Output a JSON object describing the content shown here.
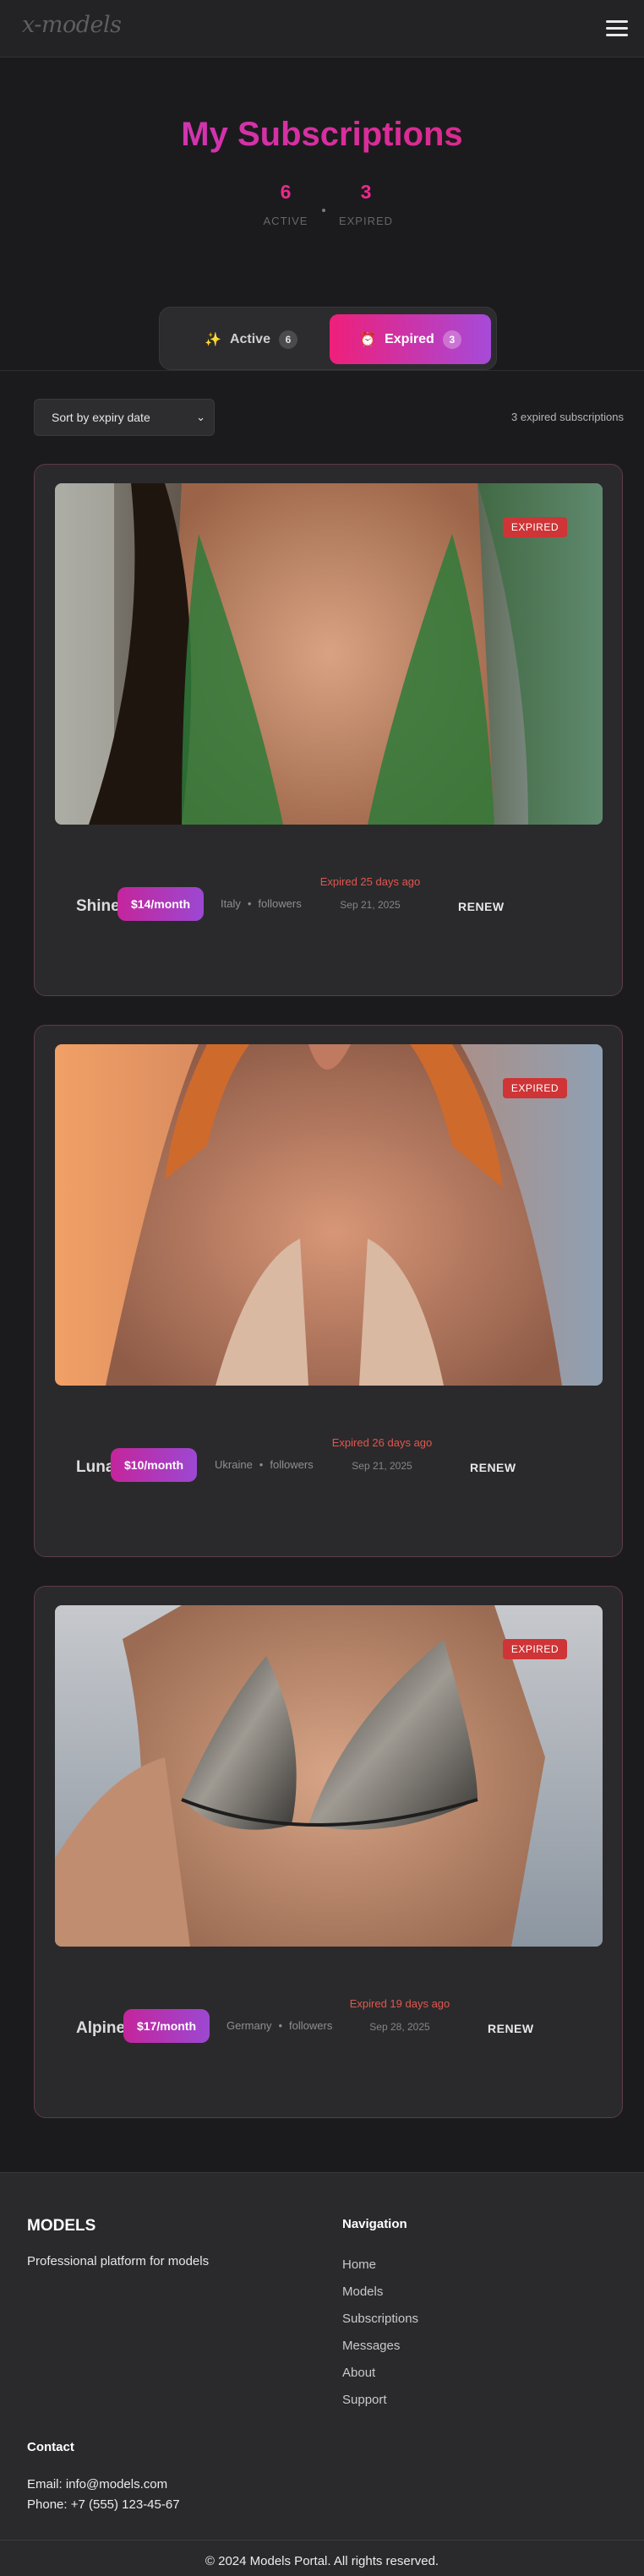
{
  "header": {
    "logo_text": "x-models",
    "menu_icon": "hamburger-icon"
  },
  "page": {
    "title": "My Subscriptions",
    "stats": [
      {
        "value": "6",
        "label": "ACTIVE"
      },
      {
        "value": "3",
        "label": "EXPIRED"
      }
    ]
  },
  "tabs": [
    {
      "icon": "sparkles-icon",
      "label": "Active",
      "count": "6",
      "selected": false
    },
    {
      "icon": "alarm-clock-icon",
      "label": "Expired",
      "count": "3",
      "selected": true
    }
  ],
  "toolbar": {
    "sort_value": "Sort by expiry date",
    "count_text": "3 expired subscriptions"
  },
  "subscriptions": [
    {
      "name": "Shine",
      "price": "$14/month",
      "country": "Italy",
      "followers": "followers",
      "expired_text": "Expired 25 days ago",
      "expired_date": "Sep 21, 2025",
      "badge": "EXPIRED",
      "action": "RENEW"
    },
    {
      "name": "Luna",
      "price": "$10/month",
      "country": "Ukraine",
      "followers": "followers",
      "expired_text": "Expired 26 days ago",
      "expired_date": "Sep 21, 2025",
      "badge": "EXPIRED",
      "action": "RENEW"
    },
    {
      "name": "Alpine",
      "price": "$17/month",
      "country": "Germany",
      "followers": "followers",
      "expired_text": "Expired 19 days ago",
      "expired_date": "Sep 28, 2025",
      "badge": "EXPIRED",
      "action": "RENEW"
    }
  ],
  "footer": {
    "brand": "MODELS",
    "tagline": "Professional platform for models",
    "nav_heading": "Navigation",
    "nav_links": [
      "Home",
      "Models",
      "Subscriptions",
      "Messages",
      "About",
      "Support"
    ],
    "contact_heading": "Contact",
    "email": "Email: info@models.com",
    "phone": "Phone: +7 (555) 123-45-67",
    "copyright": "© 2024 Models Portal. All rights reserved."
  },
  "colors": {
    "accent_pink": "#ec2a8b",
    "accent_purple": "#a64ad9",
    "expired_red": "#cf3436",
    "background": "#1b1b1d"
  }
}
